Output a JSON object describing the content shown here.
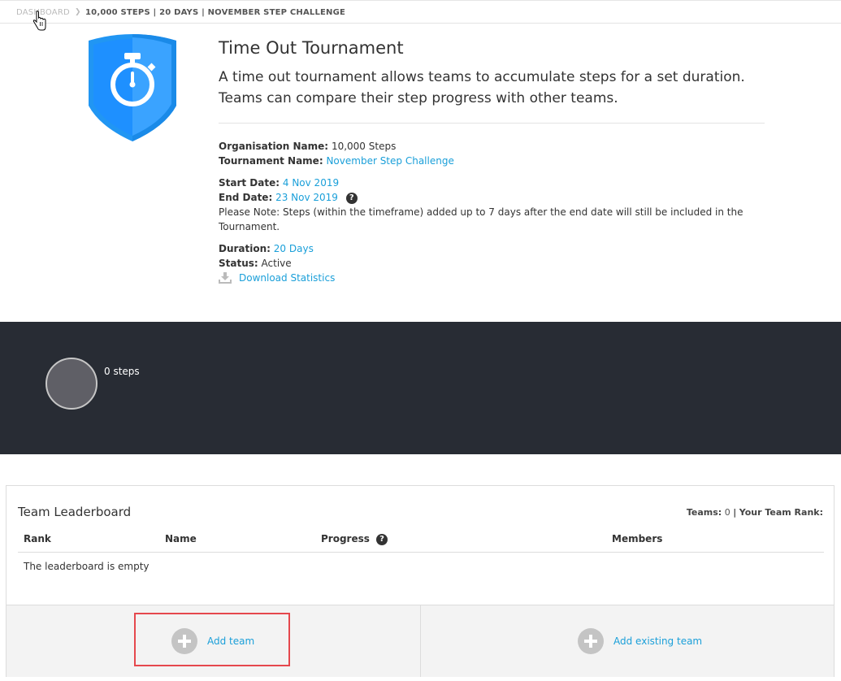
{
  "breadcrumb": {
    "home": "DASHBOARD",
    "current": "10,000 STEPS | 20 DAYS | NOVEMBER STEP CHALLENGE"
  },
  "tournament": {
    "title": "Time Out Tournament",
    "description_line1": "A time out tournament allows teams to accumulate steps for a set duration.",
    "description_line2": "Teams can compare their step progress with other teams.",
    "org_label": "Organisation Name:",
    "org_value": "10,000 Steps",
    "name_label": "Tournament Name:",
    "name_value": "November Step Challenge",
    "start_label": "Start Date:",
    "start_value": "4 Nov 2019",
    "end_label": "End Date:",
    "end_value": "23 Nov 2019",
    "note_line1": "Please Note: Steps (within the timeframe) added up to 7 days after the end date will still be included in the",
    "note_line2": "Tournament.",
    "duration_label": "Duration:",
    "duration_value": "20 Days",
    "status_label": "Status:",
    "status_value": "Active",
    "download_label": "Download Statistics"
  },
  "progress": {
    "steps_text": "0 steps"
  },
  "leaderboard": {
    "title": "Team Leaderboard",
    "teams_label": "Teams:",
    "teams_value": "0",
    "separator": "|",
    "rank_label": "Your Team Rank:",
    "columns": {
      "rank": "Rank",
      "name": "Name",
      "progress": "Progress",
      "members": "Members"
    },
    "empty_text": "The leaderboard is empty",
    "add_team": "Add team",
    "add_existing": "Add existing team"
  },
  "icons": {
    "help": "?",
    "crumb_separator": ">"
  },
  "colors": {
    "accent": "#1a9fd9",
    "dark_band": "#282c34",
    "badge_blue": "#1e88f5",
    "highlight": "#e5484d"
  }
}
